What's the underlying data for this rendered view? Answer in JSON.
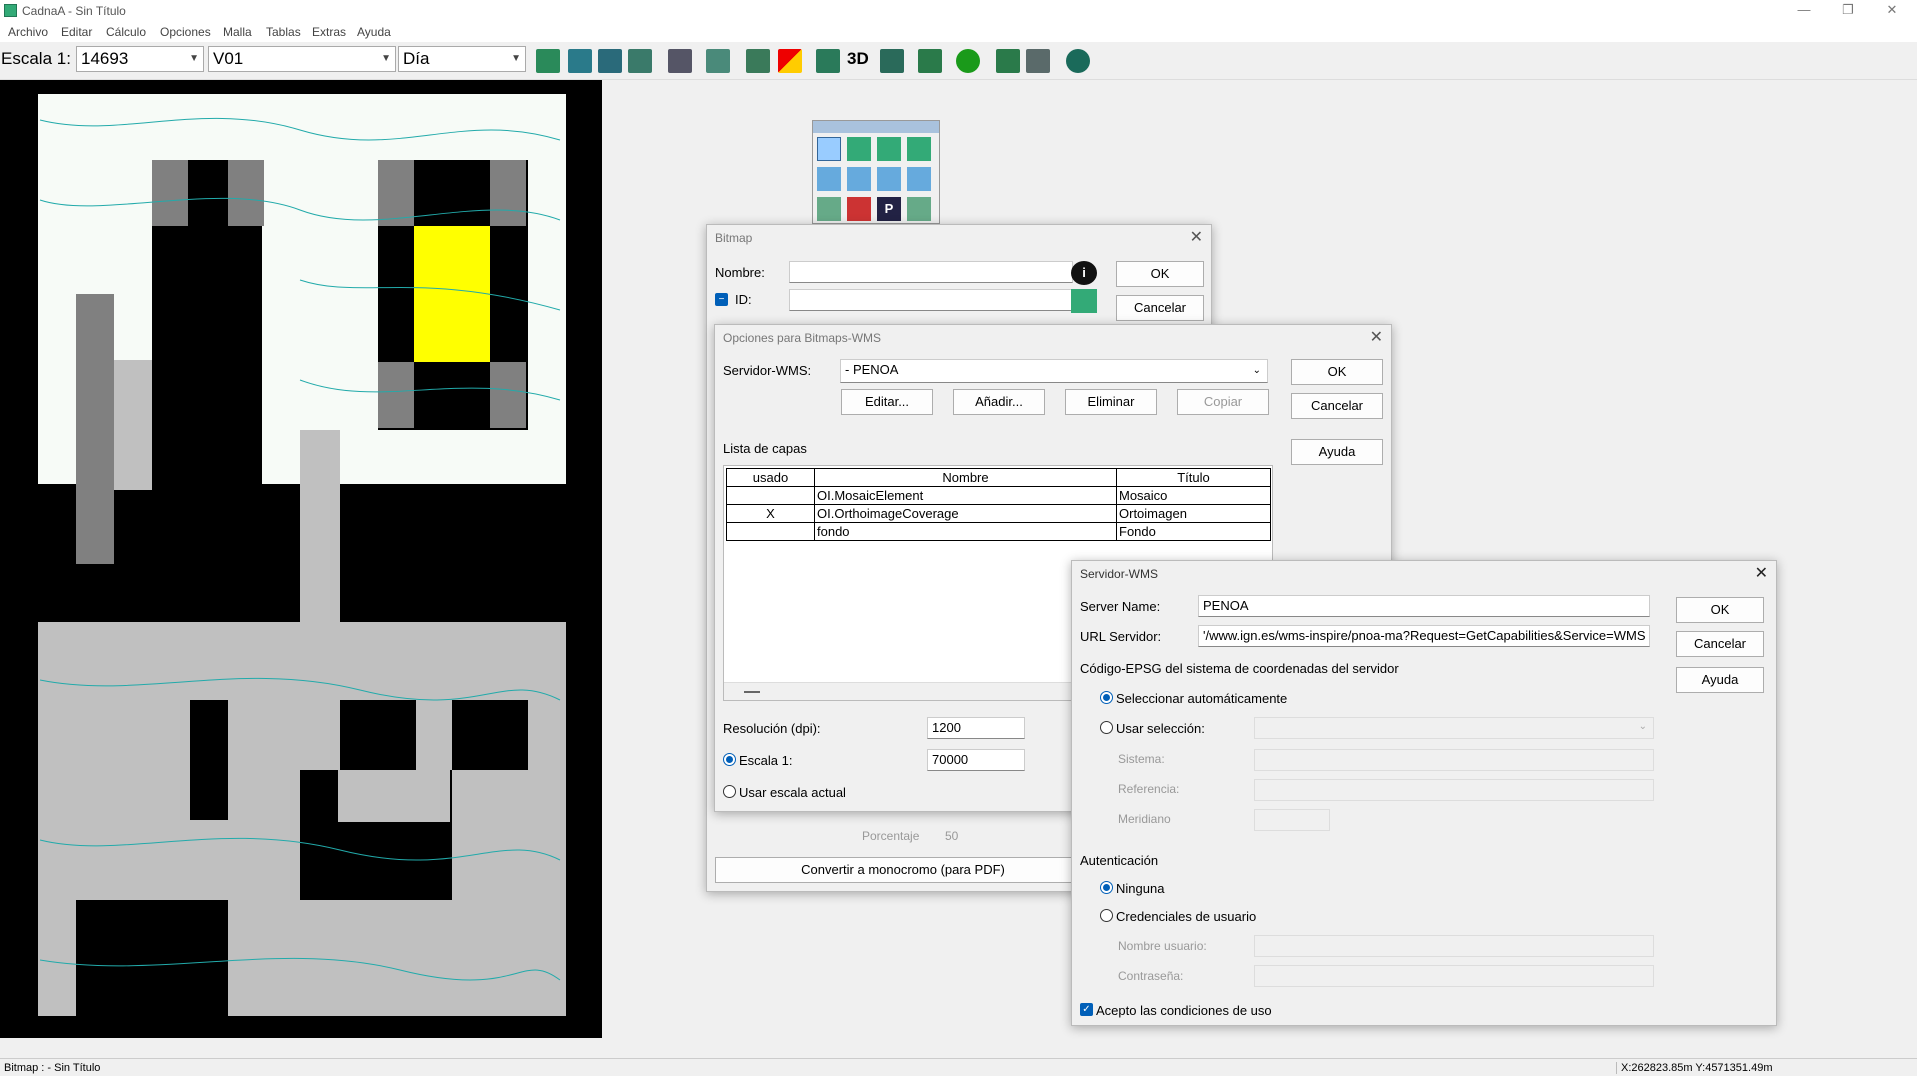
{
  "app": {
    "title": "CadnaA - Sin Título"
  },
  "menu": [
    "Archivo",
    "Editar",
    "Cálculo",
    "Opciones",
    "Malla",
    "Tablas",
    "Extras",
    "Ayuda"
  ],
  "toolbar": {
    "scale_label": "Escala 1:",
    "scale_value": "14693",
    "variant": "V01",
    "period": "Día",
    "label_3d": "3D"
  },
  "bitmap_dialog": {
    "title": "Bitmap",
    "name_label": "Nombre:",
    "id_label": "ID:",
    "ok": "OK",
    "cancel": "Cancelar",
    "percent_label": "Porcentaje",
    "percent_value": "50",
    "mono_button": "Convertir a monocromo (para PDF)"
  },
  "wms_options": {
    "title": "Opciones para Bitmaps-WMS",
    "server_label": "Servidor-WMS:",
    "server_value": "- PENOA",
    "edit": "Editar...",
    "add": "Añadir...",
    "delete": "Eliminar",
    "copy": "Copiar",
    "ok": "OK",
    "cancel": "Cancelar",
    "help": "Ayuda",
    "layers_label": "Lista de capas",
    "columns": [
      "usado",
      "Nombre",
      "Título"
    ],
    "rows": [
      {
        "used": "",
        "name": "OI.MosaicElement",
        "title": "Mosaico"
      },
      {
        "used": "X",
        "name": "OI.OrthoimageCoverage",
        "title": "Ortoimagen"
      },
      {
        "used": "",
        "name": "fondo",
        "title": "Fondo"
      }
    ],
    "resolution_label": "Resolución (dpi):",
    "resolution_value": "1200",
    "scale_label": "Escala 1:",
    "scale_value": "70000",
    "current_scale_label": "Usar escala actual"
  },
  "wms_server": {
    "title": "Servidor-WMS",
    "name_label": "Server Name:",
    "name_value": "PENOA",
    "url_label": "URL Servidor:",
    "url_value": "'/www.ign.es/wms-inspire/pnoa-ma?Request=GetCapabilities&Service=WMS",
    "ok": "OK",
    "cancel": "Cancelar",
    "help": "Ayuda",
    "epsg_label": "Código-EPSG del sistema de coordenadas del servidor",
    "auto_label": "Seleccionar automáticamente",
    "manual_label": "Usar selección:",
    "system_label": "Sistema:",
    "reference_label": "Referencia:",
    "meridian_label": "Meridiano",
    "auth_label": "Autenticación",
    "none_label": "Ninguna",
    "creds_label": "Credenciales de usuario",
    "user_label": "Nombre usuario:",
    "password_label": "Contraseña:",
    "accept_label": "Acepto las condiciones de uso"
  },
  "status": {
    "left": "Bitmap : - Sin Título",
    "coords": "X:262823.85m Y:4571351.49m"
  }
}
